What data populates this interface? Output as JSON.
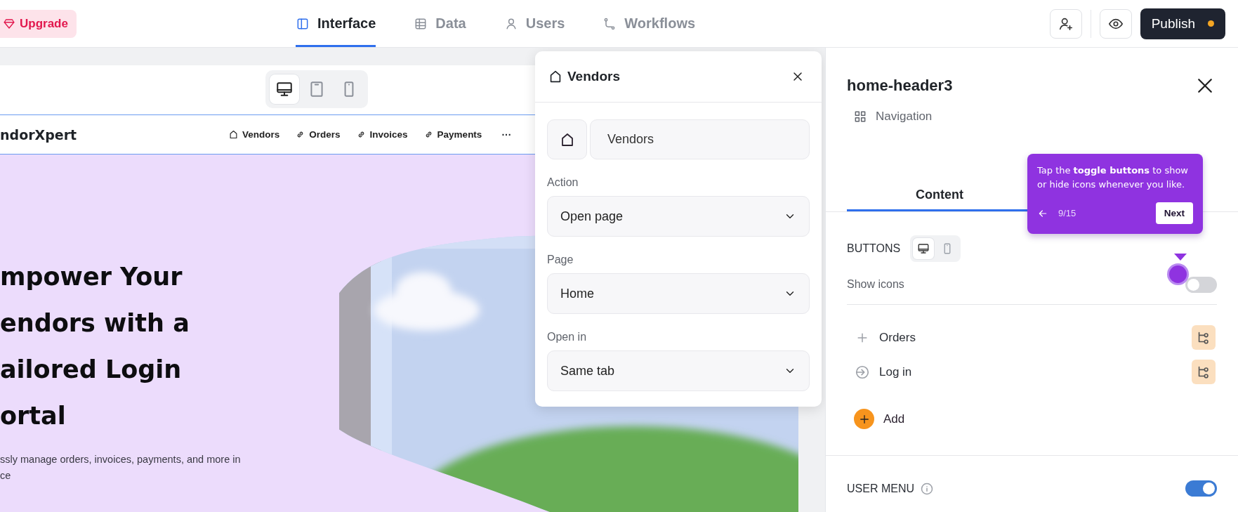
{
  "topbar": {
    "upgrade": "Upgrade",
    "tabs": [
      {
        "label": "Interface",
        "kind": "panel",
        "selected": true
      },
      {
        "label": "Data",
        "kind": "table",
        "selected": false
      },
      {
        "label": "Users",
        "kind": "user",
        "selected": false
      },
      {
        "label": "Workflows",
        "kind": "flow",
        "selected": false
      }
    ],
    "publish": "Publish"
  },
  "canvas": {
    "devices": [
      {
        "kind": "desktop",
        "selected": true
      },
      {
        "kind": "tablet",
        "selected": false
      },
      {
        "kind": "phone",
        "selected": false
      }
    ],
    "preview": {
      "logo": "ndorXpert",
      "nav": [
        {
          "label": "Vendors",
          "kind": "home"
        },
        {
          "label": "Orders",
          "kind": "link"
        },
        {
          "label": "Invoices",
          "kind": "link"
        },
        {
          "label": "Payments",
          "kind": "link"
        }
      ],
      "more": "···",
      "hero": {
        "title_lines": [
          "mpower Your",
          "endors with a",
          "ailored Login",
          "ortal"
        ],
        "subtitle_lines": [
          "ssly manage orders, invoices, payments, and more in",
          "ce"
        ],
        "image": {
          "kind": "picture"
        }
      }
    }
  },
  "link_editor": {
    "title": "Vendors",
    "name": "Vendors",
    "fields": [
      {
        "label": "Action",
        "value": "Open page"
      },
      {
        "label": "Page",
        "value": "Home"
      },
      {
        "label": "Open in",
        "value": "Same tab"
      }
    ]
  },
  "inspector": {
    "title": "home-header3",
    "component": "Navigation",
    "tabs": [
      {
        "label": "Content",
        "selected": true
      }
    ],
    "buttons_section": {
      "heading": "BUTTONS",
      "devices": [
        {
          "kind": "desktop",
          "selected": true
        },
        {
          "kind": "phone",
          "selected": false
        }
      ],
      "show_icons": {
        "label": "Show icons",
        "on": false
      },
      "items": [
        {
          "label": "Orders",
          "kind": "plus"
        },
        {
          "label": "Log in",
          "kind": "login"
        }
      ],
      "add": "Add"
    },
    "user_menu": {
      "label": "USER MENU",
      "on": true
    }
  },
  "tour_tip": {
    "text": "Tap the **toggle buttons** to show or hide icons whenever you like.",
    "step": "9/15",
    "next": "Next"
  }
}
